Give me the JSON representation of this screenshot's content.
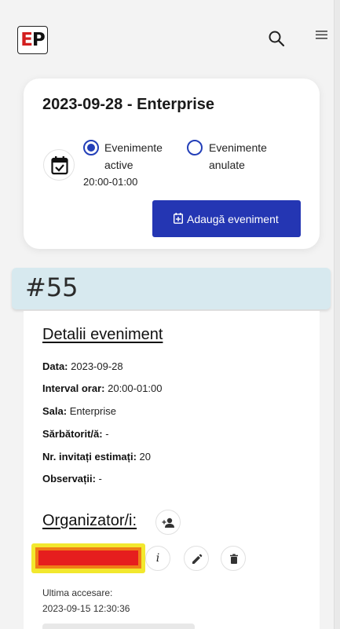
{
  "header": {
    "logo_text_e": "E",
    "logo_text_p": "P",
    "search_icon": "search-icon",
    "menu_icon": "menu-icon"
  },
  "event_card": {
    "title": "2023-09-28 - Enterprise",
    "radio_active_label": "Evenimente active",
    "radio_cancel_label": "Evenimente anulate",
    "radio_selected": "active",
    "time": "20:00-01:00",
    "add_button_label": "Adaugă eveniment",
    "accent_color": "#2436b3"
  },
  "banner": {
    "text": "#55"
  },
  "details": {
    "title": "Detalii eveniment",
    "rows": [
      {
        "label": "Data:",
        "value": "2023-09-28"
      },
      {
        "label": "Interval orar:",
        "value": "20:00-01:00"
      },
      {
        "label": "Sala:",
        "value": "Enterprise"
      },
      {
        "label": "Sărbătorit/ă:",
        "value": "-"
      },
      {
        "label": "Nr. invitați estimați:",
        "value": "20"
      },
      {
        "label": "Observații:",
        "value": "-"
      }
    ],
    "organizer_title": "Organizator/i:",
    "info_label": "i",
    "last_access_label": "Ultima accesare:",
    "last_access_value": "2023-09-15 12:30:36"
  }
}
